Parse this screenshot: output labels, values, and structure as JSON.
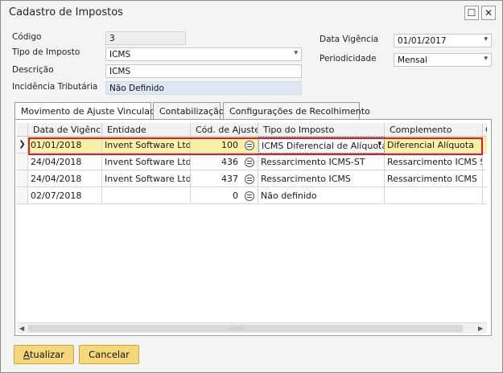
{
  "window": {
    "title": "Cadastro de Impostos"
  },
  "form": {
    "codigo_label": "Código",
    "codigo_value": "3",
    "tipo_label": "Tipo de Imposto",
    "tipo_value": "ICMS",
    "descricao_label": "Descrição",
    "descricao_value": "ICMS",
    "incidencia_label": "Incidência Tributária",
    "incidencia_value": "Não Definido",
    "data_vigencia_label": "Data Vigência",
    "data_vigencia_value": "01/01/2017",
    "periodicidade_label": "Periodicidade",
    "periodicidade_value": "Mensal"
  },
  "tabs": [
    {
      "label": "Movimento de Ajuste Vinculado"
    },
    {
      "label": "Contabilização"
    },
    {
      "label": "Configurações de Recolhimento"
    }
  ],
  "grid": {
    "columns": [
      "Data de Vigência",
      "Entidade",
      "Cód. de Ajuste",
      "Tipo do Imposto",
      "Complemento",
      "C"
    ],
    "rows": [
      {
        "data": "01/01/2018",
        "entidade": "Invent Software Ltda",
        "cod": "100",
        "tipo": "ICMS Diferencial de Alíquota",
        "complemento": "Diferencial Alíquota"
      },
      {
        "data": "24/04/2018",
        "entidade": "Invent Software Ltda",
        "cod": "436",
        "tipo": "Ressarcimento ICMS-ST",
        "complemento": "Ressarcimento ICMS ST"
      },
      {
        "data": "24/04/2018",
        "entidade": "Invent Software Ltda",
        "cod": "437",
        "tipo": "Ressarcimento ICMS",
        "complemento": "Ressarcimento ICMS"
      },
      {
        "data": "02/07/2018",
        "entidade": "",
        "cod": "0",
        "tipo": "Não definido",
        "complemento": ""
      }
    ]
  },
  "buttons": {
    "atualizar_first": "A",
    "atualizar_rest": "tualizar",
    "cancelar": "Cancelar"
  },
  "icons": {
    "maximize": "☐",
    "close": "✕",
    "dropdown": "▾",
    "row_pointer": "❯"
  }
}
